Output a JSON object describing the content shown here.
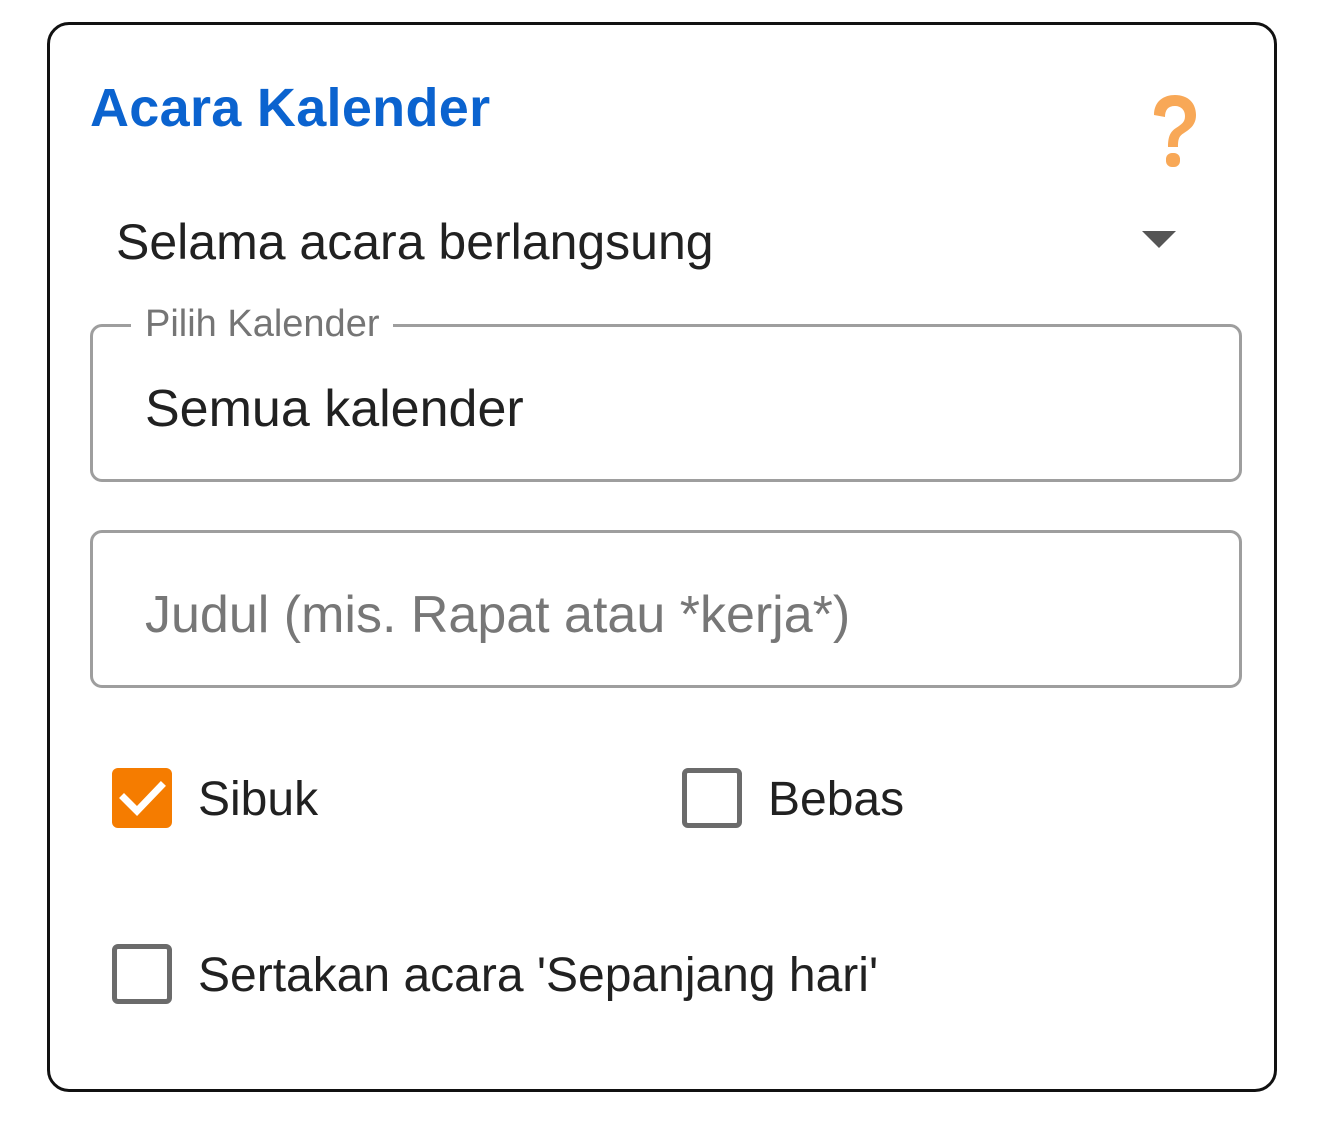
{
  "header": {
    "title": "Acara Kalender"
  },
  "timing_dropdown": {
    "selected": "Selama acara berlangsung"
  },
  "calendar_field": {
    "label": "Pilih Kalender",
    "value": "Semua kalender"
  },
  "title_field": {
    "placeholder": "Judul (mis. Rapat atau *kerja*)",
    "value": ""
  },
  "checkboxes": {
    "busy": {
      "label": "Sibuk",
      "checked": true
    },
    "free": {
      "label": "Bebas",
      "checked": false
    },
    "all_day": {
      "label": "Sertakan acara 'Sepanjang hari'",
      "checked": false
    }
  },
  "colors": {
    "title": "#0b63cf",
    "accent": "#f57c00",
    "help_icon": "#f8a857"
  },
  "icons": {
    "help": "question-mark-icon",
    "dropdown": "caret-down-icon",
    "checked": "checkmark-icon"
  }
}
